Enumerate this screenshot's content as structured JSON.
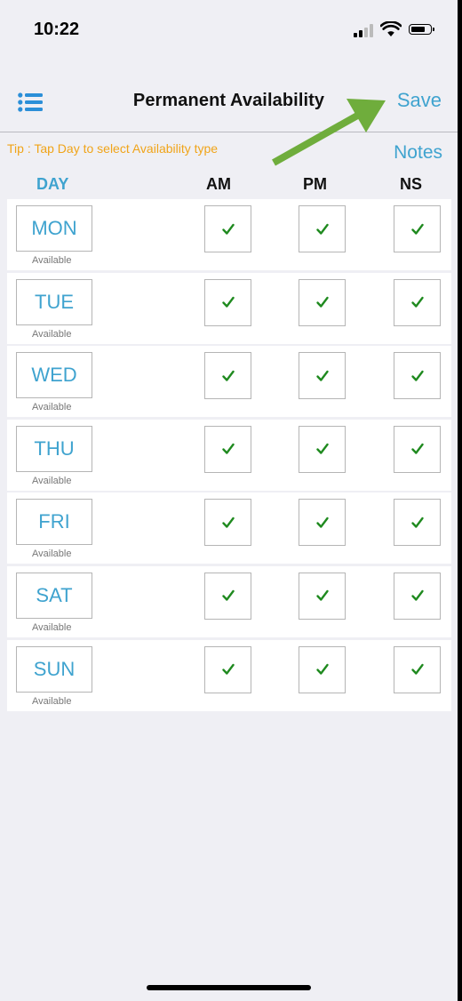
{
  "status_bar": {
    "time": "10:22"
  },
  "nav": {
    "title": "Permanent Availability",
    "save_label": "Save",
    "menu_icon": "list-icon"
  },
  "tip": "Tip : Tap Day to select Availability type",
  "notes_label": "Notes",
  "headers": {
    "day": "DAY",
    "am": "AM",
    "pm": "PM",
    "ns": "NS"
  },
  "colors": {
    "accent": "#3fa3cf",
    "tip": "#f0a419",
    "check": "#1f8a1f",
    "annotation_arrow": "#6fad3c",
    "background": "#efeff4"
  },
  "days": [
    {
      "day": "MON",
      "status": "Available",
      "am": true,
      "pm": true,
      "ns": true
    },
    {
      "day": "TUE",
      "status": "Available",
      "am": true,
      "pm": true,
      "ns": true
    },
    {
      "day": "WED",
      "status": "Available",
      "am": true,
      "pm": true,
      "ns": true
    },
    {
      "day": "THU",
      "status": "Available",
      "am": true,
      "pm": true,
      "ns": true
    },
    {
      "day": "FRI",
      "status": "Available",
      "am": true,
      "pm": true,
      "ns": true
    },
    {
      "day": "SAT",
      "status": "Available",
      "am": true,
      "pm": true,
      "ns": true
    },
    {
      "day": "SUN",
      "status": "Available",
      "am": true,
      "pm": true,
      "ns": true
    }
  ]
}
